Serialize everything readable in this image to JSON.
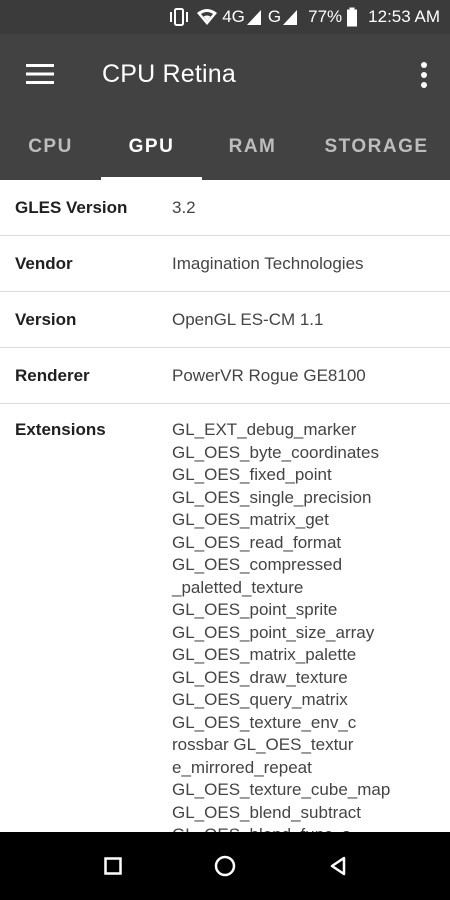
{
  "status_bar": {
    "network_4g": "4G",
    "network_g": "G",
    "battery": "77%",
    "time": "12:53 AM",
    "icons": [
      "vibrate-icon",
      "wifi-icon",
      "signal-icon",
      "signal-icon",
      "battery-icon"
    ]
  },
  "app_bar": {
    "title": "CPU Retina",
    "menu_icon": "hamburger-menu-icon",
    "more_icon": "more-vertical-icon"
  },
  "tabs": [
    {
      "label": "CPU",
      "active": false
    },
    {
      "label": "GPU",
      "active": true
    },
    {
      "label": "RAM",
      "active": false
    },
    {
      "label": "STORAGE",
      "active": false
    }
  ],
  "info_rows": [
    {
      "label": "GLES Version",
      "value": "3.2"
    },
    {
      "label": "Vendor",
      "value": "Imagination Technologies"
    },
    {
      "label": "Version",
      "value": "OpenGL ES-CM 1.1"
    },
    {
      "label": "Renderer",
      "value": "PowerVR Rogue GE8100"
    }
  ],
  "extensions": {
    "label": "Extensions",
    "lines": [
      "GL_EXT_debug_marker",
      "GL_OES_byte_coordinates",
      "GL_OES_fixed_point",
      "GL_OES_single_precision",
      "GL_OES_matrix_get",
      "GL_OES_read_format",
      "GL_OES_compressed",
      "_paletted_texture",
      "GL_OES_point_sprite",
      "GL_OES_point_size_array",
      "GL_OES_matrix_palette",
      "GL_OES_draw_texture",
      "GL_OES_query_matrix",
      "GL_OES_texture_env_c",
      "rossbar GL_OES_textur",
      "e_mirrored_repeat",
      "GL_OES_texture_cube_map",
      "GL_OES_blend_subtract",
      "GL_OES_blend_func_s"
    ]
  },
  "nav_bar": {
    "icons": [
      "recent-apps-icon",
      "home-icon",
      "back-icon"
    ]
  },
  "colors": {
    "status_bar": "#3b3b3b",
    "app_bar": "#424242",
    "tab_active": "#ffffff",
    "tab_inactive": "#bdbdbd",
    "nav_bar": "#000000"
  }
}
